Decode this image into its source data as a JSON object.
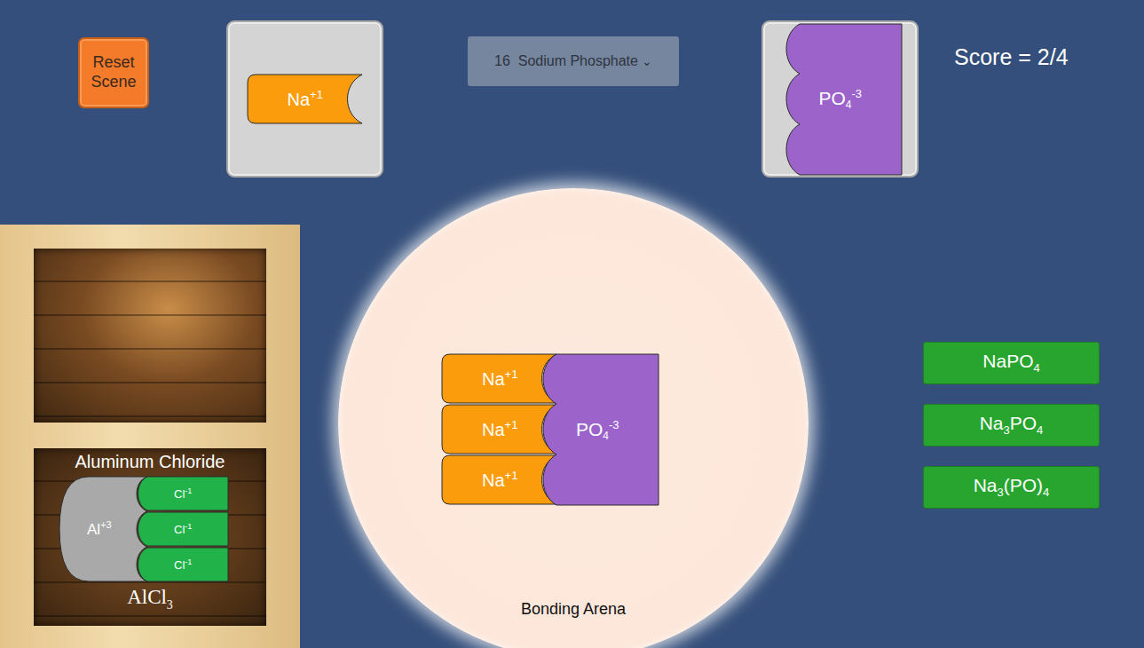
{
  "reset_button": {
    "label": "Reset Scene"
  },
  "ion_cards": [
    {
      "symbol": "Na",
      "charge": "+1",
      "kind": "cation"
    },
    {
      "symbol": "PO",
      "sub": "4",
      "charge": "-3",
      "kind": "anion"
    }
  ],
  "dropdown": {
    "value": "16  Sodium Phosphate",
    "caret": "⌄"
  },
  "score": "Score = 2/4",
  "shelf": [
    {
      "empty": true
    },
    {
      "empty": false,
      "name": "Aluminum Chloride",
      "formula": [
        {
          "text": "AlCl",
          "sub": "3"
        }
      ],
      "cation": {
        "symbol": "Al",
        "charge": "+3"
      },
      "anions": [
        {
          "symbol": "Cl",
          "charge": "-1"
        },
        {
          "symbol": "Cl",
          "charge": "-1"
        },
        {
          "symbol": "Cl",
          "charge": "-1"
        }
      ]
    }
  ],
  "arena": {
    "label": "Bonding Arena",
    "cations": [
      {
        "symbol": "Na",
        "charge": "+1"
      },
      {
        "symbol": "Na",
        "charge": "+1"
      },
      {
        "symbol": "Na",
        "charge": "+1"
      }
    ],
    "anion": {
      "symbol": "PO",
      "sub": "4",
      "charge": "-3"
    }
  },
  "answers": [
    {
      "parts": [
        {
          "text": "NaPO",
          "sub": "4"
        }
      ]
    },
    {
      "parts": [
        {
          "text": "Na",
          "sub": "3"
        },
        {
          "text": "PO",
          "sub": "4"
        }
      ]
    },
    {
      "parts": [
        {
          "text": "Na",
          "sub": "3"
        },
        {
          "text": "(PO)",
          "sub": "4"
        }
      ]
    }
  ]
}
